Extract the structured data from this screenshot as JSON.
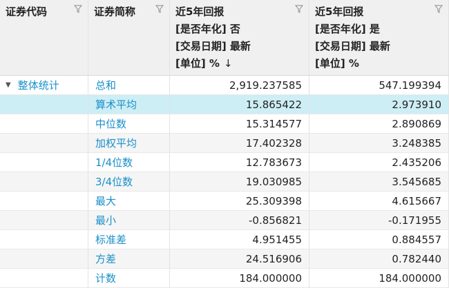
{
  "columns": [
    {
      "lines": [
        "证券代码"
      ]
    },
    {
      "lines": [
        "证券简称"
      ]
    },
    {
      "lines": [
        "近5年回报",
        "[是否年化] 否",
        "[交易日期] 最新",
        "[单位] %"
      ],
      "sort": "↓"
    },
    {
      "lines": [
        "近5年回报",
        "[是否年化] 是",
        "[交易日期] 最新",
        "[单位] %"
      ]
    }
  ],
  "group": {
    "label": "整体统计",
    "expander": "▼"
  },
  "rows": [
    {
      "name": "总和",
      "v1": "2,919.237585",
      "v2": "547.199394"
    },
    {
      "name": "算术平均",
      "v1": "15.865422",
      "v2": "2.973910"
    },
    {
      "name": "中位数",
      "v1": "15.314577",
      "v2": "2.890869"
    },
    {
      "name": "加权平均",
      "v1": "17.402328",
      "v2": "3.248385"
    },
    {
      "name": "1/4位数",
      "v1": "12.783673",
      "v2": "2.435206"
    },
    {
      "name": "3/4位数",
      "v1": "19.030985",
      "v2": "3.545685"
    },
    {
      "name": "最大",
      "v1": "25.309398",
      "v2": "4.615667"
    },
    {
      "name": "最小",
      "v1": "-0.856821",
      "v2": "-0.171955"
    },
    {
      "name": "标准差",
      "v1": "4.951455",
      "v2": "0.884557"
    },
    {
      "name": "方差",
      "v1": "24.516906",
      "v2": "0.782440"
    },
    {
      "name": "计数",
      "v1": "184.000000",
      "v2": "184.000000"
    }
  ],
  "selected_row": 1,
  "colors": {
    "header_bg": "#f0f0f0",
    "selected_bg": "#cdeef5",
    "link": "#1a8fc9",
    "alt_row": "#f5f5f5"
  }
}
